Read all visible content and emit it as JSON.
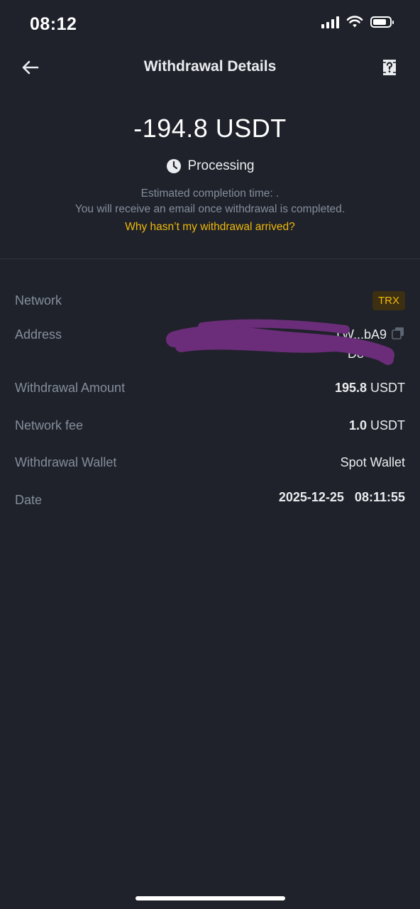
{
  "status_bar": {
    "time": "08:12",
    "battery_level": 0.8
  },
  "nav": {
    "title": "Withdrawal Details",
    "back_icon": "arrow-left-icon",
    "help_icon": "help-document-icon"
  },
  "summary": {
    "amount": "-194.8 USDT",
    "status": "Processing",
    "status_icon": "clock-icon",
    "estimated_time": "Estimated completion time: .",
    "email_note": "You will receive an email once withdrawal is completed.",
    "why_link": "Why hasn’t my withdrawal arrived?"
  },
  "details": {
    "network": {
      "label": "Network",
      "value": "TRX"
    },
    "address": {
      "label": "Address",
      "value_line1": "TW...bA9",
      "value_line2": "D8",
      "redacted": true
    },
    "withdrawal_amount": {
      "label": "Withdrawal Amount",
      "number": "195.8",
      "unit": "USDT"
    },
    "network_fee": {
      "label": "Network fee",
      "number": "1.0",
      "unit": "USDT"
    },
    "withdrawal_wallet": {
      "label": "Withdrawal Wallet",
      "value": "Spot Wallet"
    },
    "date": {
      "label": "Date",
      "value": "2025-12-25   08:11:55"
    }
  },
  "colors": {
    "background": "#1f222a",
    "accent": "#f0b90b",
    "muted_text": "#848e9c",
    "primary_text": "#eaecef",
    "redaction": "#6b2d7a"
  }
}
